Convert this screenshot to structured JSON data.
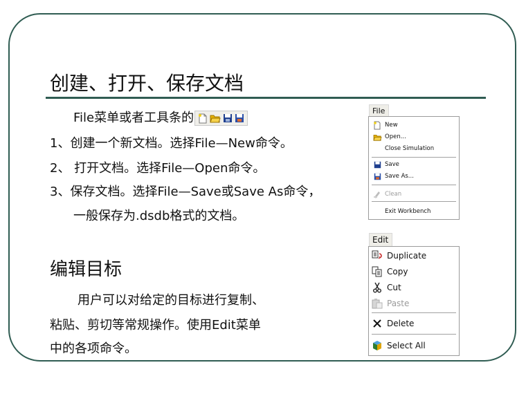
{
  "section1": {
    "title": "创建、打开、保存文档",
    "intro": "File菜单或者工具条的",
    "items": [
      "1、创建一个新文档。选择File—New命令。",
      "2、 打开文档。选择File—Open命令。",
      "3、保存文档。选择File—Save或Save As命令，",
      "一般保存为.dsdb格式的文档。"
    ],
    "toolbar_icons": [
      "new-icon",
      "open-folder-icon",
      "save-icon",
      "save-as-icon"
    ]
  },
  "section2": {
    "title": "编辑目标",
    "lines": [
      "用户可以对给定的目标进行复制、",
      "粘贴、剪切等常规操作。使用Edit菜单",
      "中的各项命令。"
    ]
  },
  "file_menu": {
    "label": "File",
    "items": [
      {
        "label": "New",
        "icon": "new-icon",
        "disabled": false
      },
      {
        "label": "Open...",
        "icon": "open-folder-icon",
        "disabled": false
      },
      {
        "label": "Close Simulation",
        "icon": "",
        "disabled": false
      },
      {
        "label": "Save",
        "icon": "save-icon",
        "disabled": false
      },
      {
        "label": "Save As...",
        "icon": "save-as-icon",
        "disabled": false
      },
      {
        "label": "Clean",
        "icon": "clean-icon",
        "disabled": true
      },
      {
        "label": "Exit Workbench",
        "icon": "",
        "disabled": false
      }
    ]
  },
  "edit_menu": {
    "label": "Edit",
    "items": [
      {
        "label": "Duplicate",
        "icon": "duplicate-icon",
        "disabled": false
      },
      {
        "label": "Copy",
        "icon": "copy-icon",
        "disabled": false
      },
      {
        "label": "Cut",
        "icon": "scissors-icon",
        "disabled": false
      },
      {
        "label": "Paste",
        "icon": "paste-icon",
        "disabled": true
      },
      {
        "label": "Delete",
        "icon": "delete-x-icon",
        "disabled": false
      },
      {
        "label": "Select All",
        "icon": "select-all-icon",
        "disabled": false
      }
    ]
  },
  "colors": {
    "frame": "#2f5c52",
    "accent_folder": "#e8b400",
    "save_blue": "#1f3f8f"
  }
}
